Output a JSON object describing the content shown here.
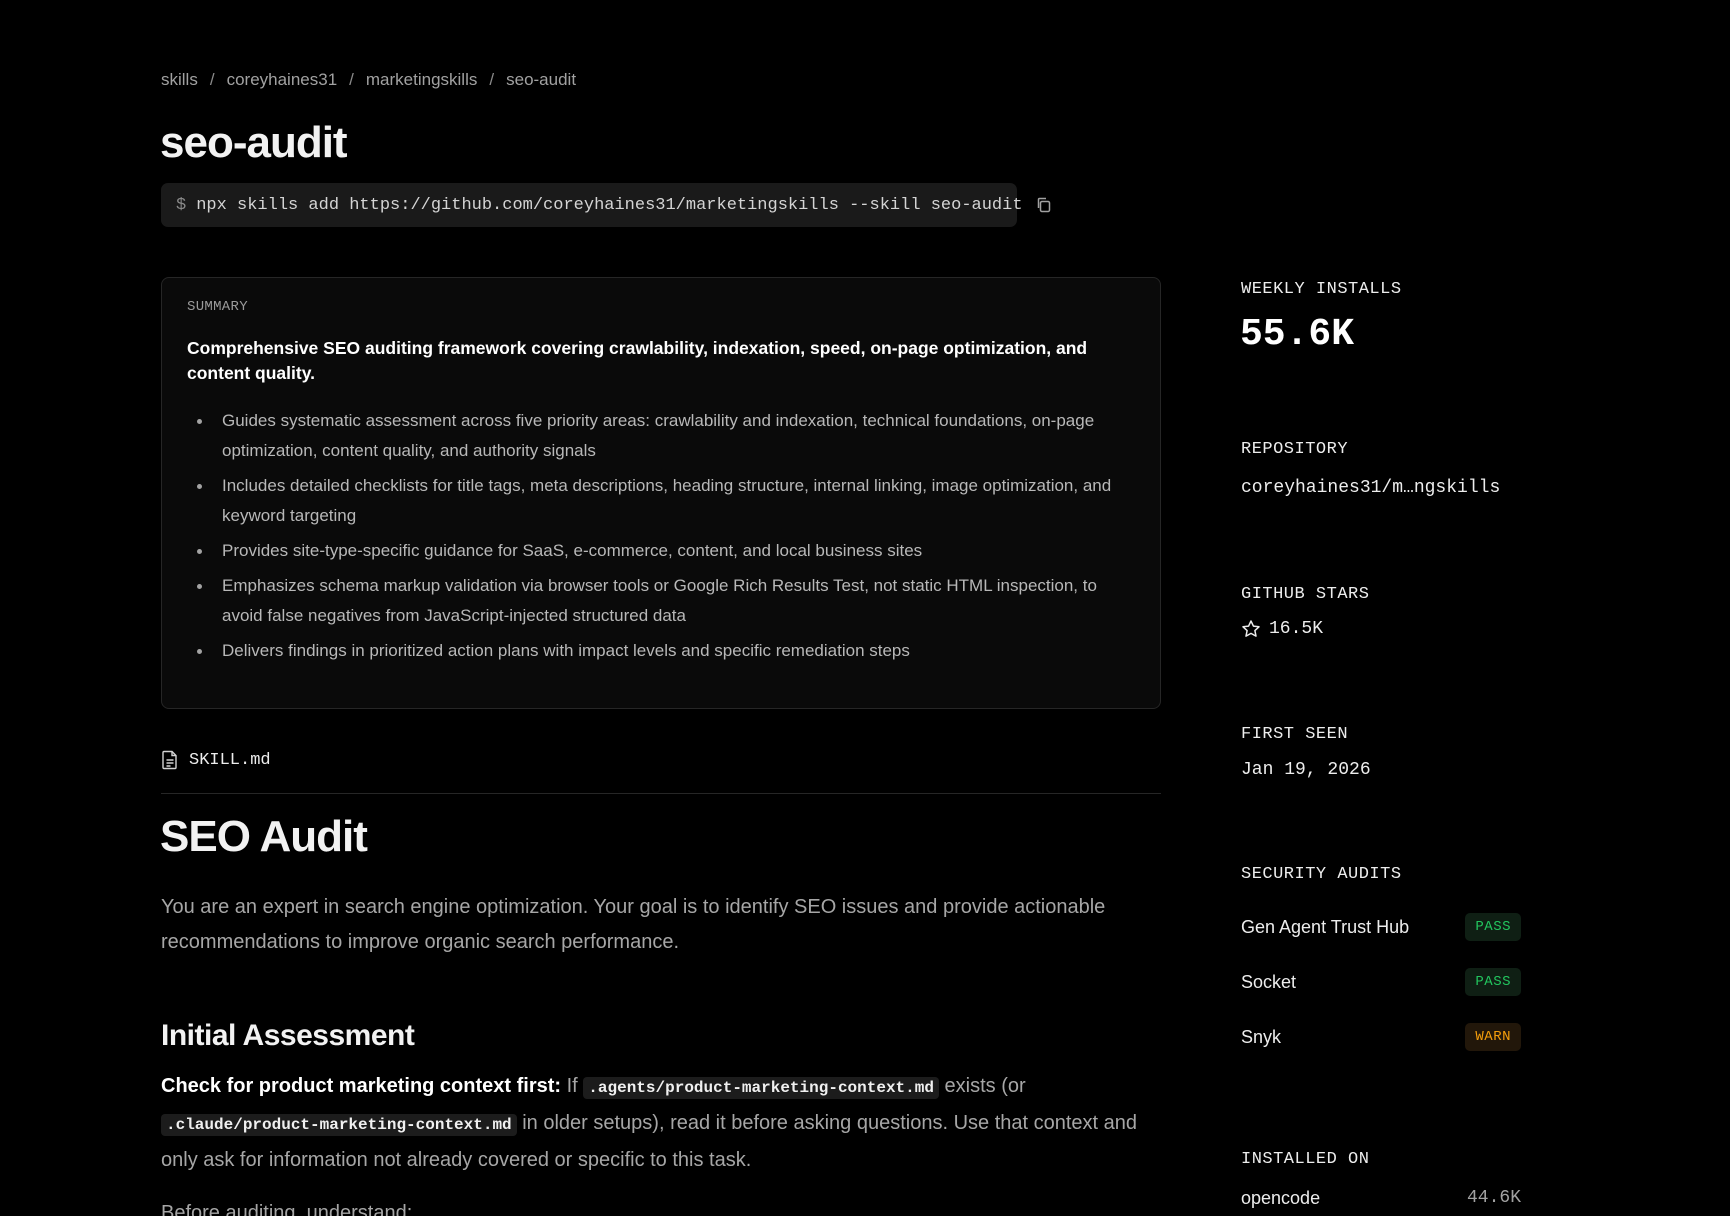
{
  "breadcrumb": [
    {
      "label": "skills"
    },
    {
      "label": "coreyhaines31"
    },
    {
      "label": "marketingskills"
    },
    {
      "label": "seo-audit"
    }
  ],
  "breadcrumb_separator": "/",
  "title": "seo-audit",
  "install": {
    "prompt": "$",
    "command": "npx skills add https://github.com/coreyhaines31/marketingskills --skill seo-audit"
  },
  "summary": {
    "label": "SUMMARY",
    "lead": "Comprehensive SEO auditing framework covering crawlability, indexation, speed, on-page optimization, and content quality.",
    "bullets": [
      "Guides systematic assessment across five priority areas: crawlability and indexation, technical foundations, on-page optimization, content quality, and authority signals",
      "Includes detailed checklists for title tags, meta descriptions, heading structure, internal linking, image optimization, and keyword targeting",
      "Provides site-type-specific guidance for SaaS, e-commerce, content, and local business sites",
      "Emphasizes schema markup validation via browser tools or Google Rich Results Test, not static HTML inspection, to avoid false negatives from JavaScript-injected structured data",
      "Delivers findings in prioritized action plans with impact levels and specific remediation steps"
    ]
  },
  "file_tab": "SKILL.md",
  "doc": {
    "h1": "SEO Audit",
    "intro": "You are an expert in search engine optimization. Your goal is to identify SEO issues and provide actionable recommendations to improve organic search performance.",
    "h2": "Initial Assessment",
    "para_strong": "Check for product marketing context first:",
    "para_t1": " If ",
    "para_code1": ".agents/product-marketing-context.md",
    "para_t2": " exists (or ",
    "para_code2": ".claude/product-marketing-context.md",
    "para_t3": " in older setups), read it before asking questions. Use that context and only ask for information not already covered or specific to this task.",
    "cut": "Before auditing, understand:"
  },
  "sidebar": {
    "weekly_installs_label": "WEEKLY INSTALLS",
    "weekly_installs": "55.6K",
    "repository_label": "REPOSITORY",
    "repository": "coreyhaines31/m…ngskills",
    "stars_label": "GITHUB STARS",
    "stars": "16.5K",
    "first_seen_label": "FIRST SEEN",
    "first_seen": "Jan 19, 2026",
    "security_label": "SECURITY AUDITS",
    "audits": [
      {
        "name": "Gen Agent Trust Hub",
        "status": "PASS"
      },
      {
        "name": "Socket",
        "status": "PASS"
      },
      {
        "name": "Snyk",
        "status": "WARN"
      }
    ],
    "installed_label": "INSTALLED ON",
    "installed": [
      {
        "name": "opencode",
        "count": "44.6K"
      }
    ]
  },
  "colors": {
    "background": "#000000",
    "card": "#0a0a0a",
    "pass": "#22c55e",
    "warn": "#f59e0b"
  }
}
